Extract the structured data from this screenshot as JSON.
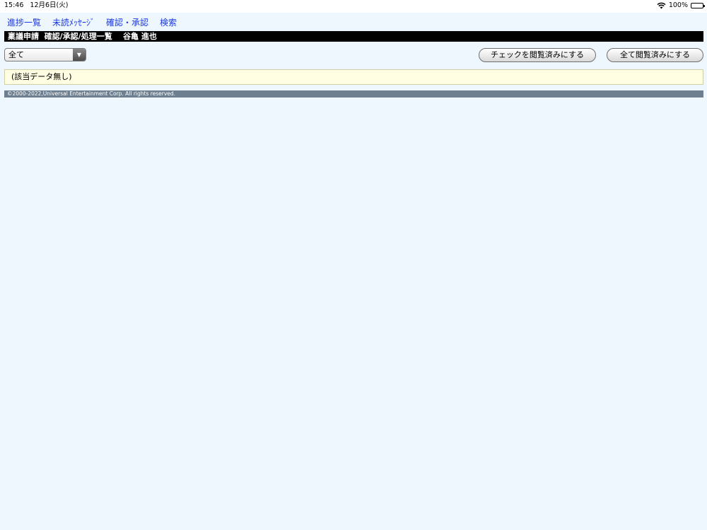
{
  "status_bar": {
    "time": "15:46",
    "date": "12月6日(火)",
    "battery": "100%"
  },
  "nav": {
    "items": [
      {
        "label": "進捗一覧"
      },
      {
        "label": "未読ﾒｯｾｰｼﾞ"
      },
      {
        "label": "確認・承認"
      },
      {
        "label": "検索"
      }
    ]
  },
  "page": {
    "title": "稟議申請  確認/承認/処理一覧    谷亀 進也"
  },
  "filter": {
    "selected": "全て"
  },
  "actions": {
    "mark_checked_read": "チェックを閲覧済みにする",
    "mark_all_read": "全て閲覧済みにする"
  },
  "results": {
    "empty_message": "(該当データ無し)"
  },
  "footer": {
    "copyright": "©2000-2022,Universal Entertainment Corp. All rights reserved."
  },
  "colors": {
    "background": "#eef6fe",
    "link": "#1a38e0",
    "titlebar": "#000000",
    "empty_box": "#fffde2",
    "footer": "#6e7f8f"
  }
}
